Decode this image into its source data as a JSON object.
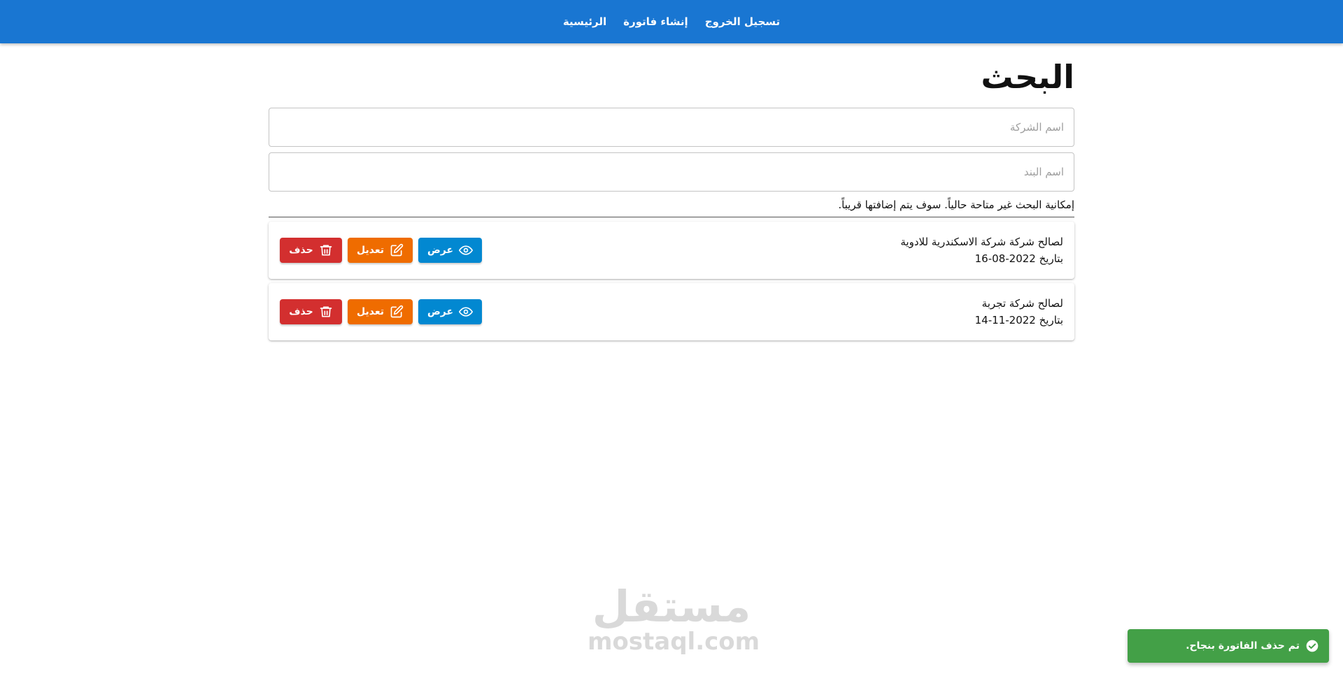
{
  "nav": {
    "items": [
      {
        "label": "الرئيسية"
      },
      {
        "label": "إنشاء فاتورة"
      },
      {
        "label": "تسجيل الخروج"
      }
    ]
  },
  "page": {
    "title": "البحث"
  },
  "search": {
    "company_placeholder": "اسم الشركة",
    "company_value": "",
    "item_placeholder": "اسم البند",
    "item_value": "",
    "notice": "إمكانية البحث غير متاحة حالياً. سوف يتم إضافتها قريباً."
  },
  "invoices": [
    {
      "company": "لصالح شركة شركة الاسكندرية للادوية",
      "date": "بتاريخ 2022-08-16",
      "view_label": "عرض",
      "edit_label": "تعديل",
      "delete_label": "حذف"
    },
    {
      "company": "لصالح شركة تجربة",
      "date": "بتاريخ 2022-11-14",
      "view_label": "عرض",
      "edit_label": "تعديل",
      "delete_label": "حذف"
    }
  ],
  "colors": {
    "navbar": "#1976d2",
    "view": "#0288d1",
    "edit": "#ef6c00",
    "delete": "#d32f2f",
    "toast": "#43a047"
  },
  "watermark": {
    "arabic": "مستقل",
    "latin": "mostaql.com"
  },
  "toast": {
    "message": "تم حذف الفاتورة بنجاح.",
    "icon": "check-circle-icon"
  }
}
